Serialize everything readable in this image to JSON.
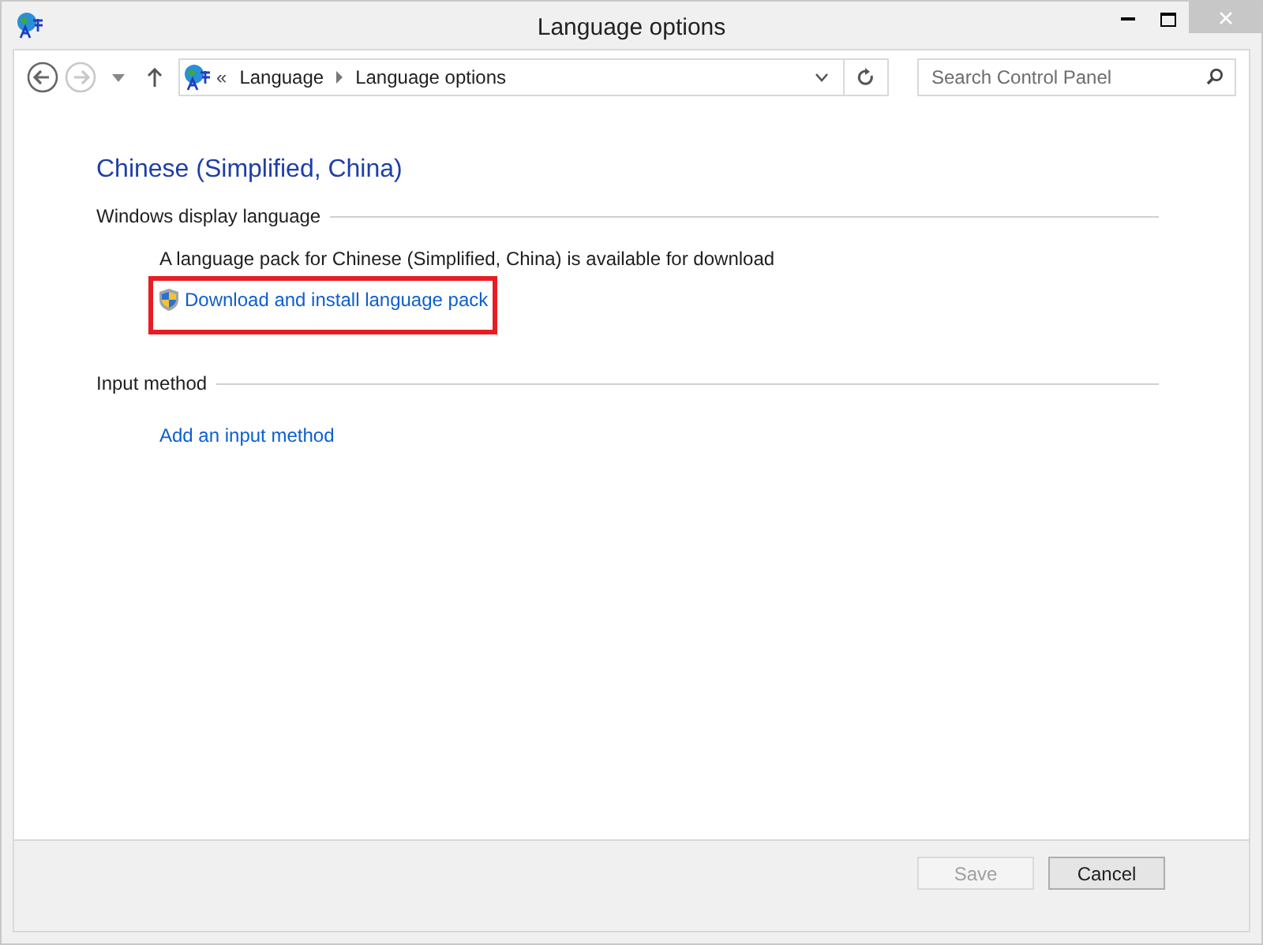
{
  "window": {
    "title": "Language options"
  },
  "address_bar": {
    "overflow": "«",
    "path": [
      {
        "label": "Language"
      },
      {
        "label": "Language options"
      }
    ]
  },
  "navigation": [
    {
      "kind": "back",
      "disabled": false
    },
    {
      "kind": "forward",
      "disabled": true
    }
  ],
  "search": {
    "placeholder": "Search Control Panel"
  },
  "heading": "Chinese (Simplified, China)",
  "sections": [
    {
      "title": "Windows display language",
      "text": "A language pack for Chinese (Simplified, China) is available for download",
      "link": {
        "label": "Download and install language pack",
        "shield": true,
        "highlighted": true
      }
    },
    {
      "title": "Input method",
      "link": {
        "label": "Add an input method",
        "shield": false,
        "highlighted": false
      }
    }
  ],
  "buttons": [
    {
      "label": "Save",
      "disabled": true
    },
    {
      "label": "Cancel",
      "disabled": false
    }
  ]
}
